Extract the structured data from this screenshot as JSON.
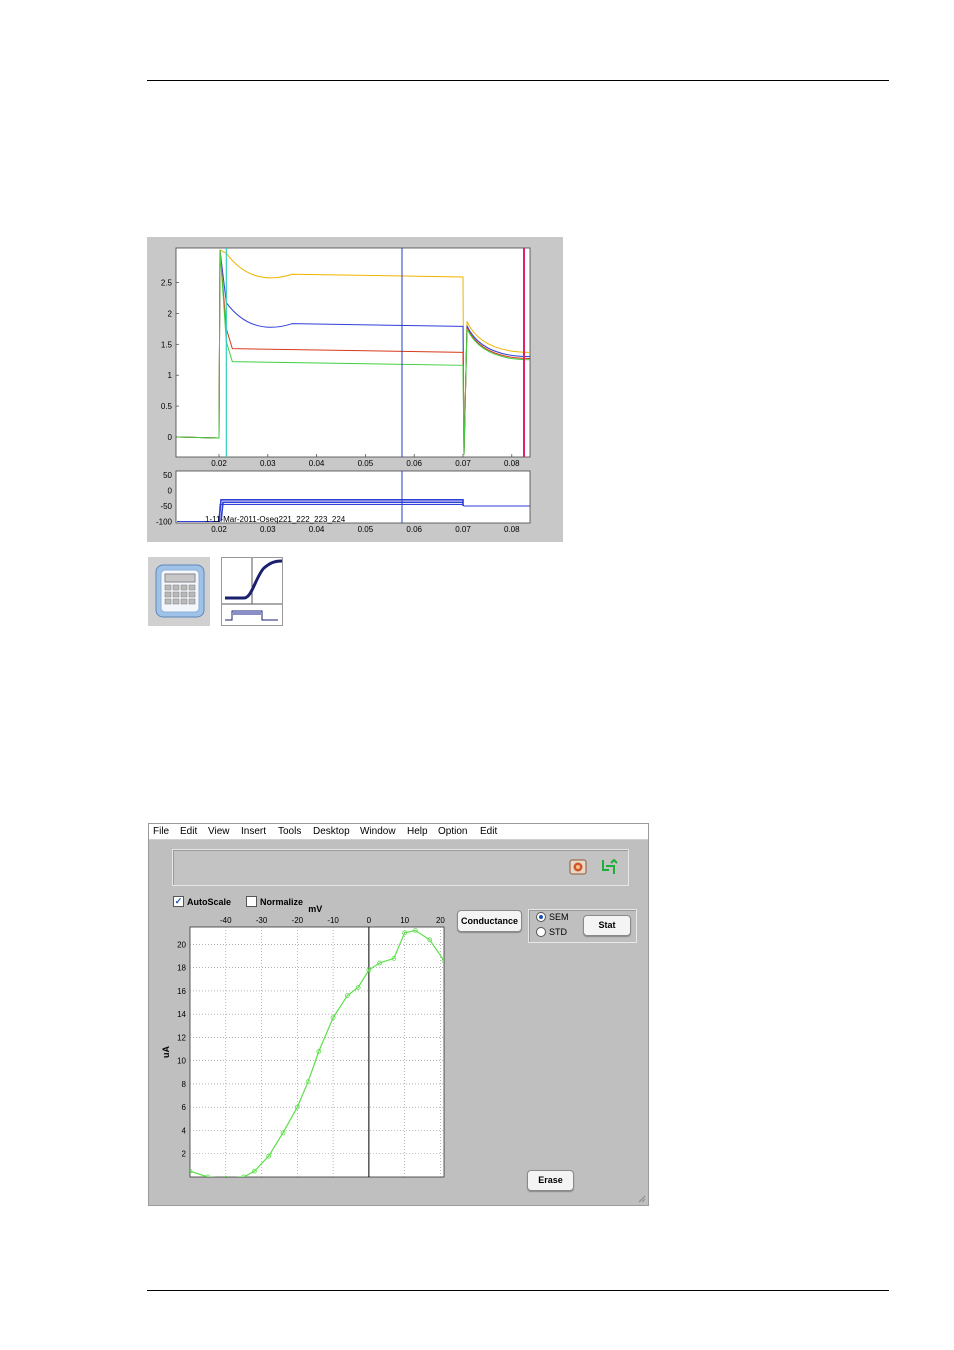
{
  "figure1": {
    "current_plot": {
      "y_ticks": [
        "2.5",
        "2",
        "1.5",
        "1",
        "0.5",
        "0"
      ],
      "x_ticks": [
        "0.02",
        "0.03",
        "0.04",
        "0.05",
        "0.06",
        "0.07",
        "0.08"
      ]
    },
    "voltage_plot": {
      "y_ticks": [
        "50",
        "0",
        "-50",
        "-100"
      ],
      "x_ticks": [
        "0.02",
        "0.03",
        "0.04",
        "0.05",
        "0.06",
        "0.07",
        "0.08"
      ],
      "annotation": "1-11-Mar-2011-Oseq221_222_223_224"
    },
    "trace_colors": {
      "orange": "#f0b400",
      "blue": "#2f3fd8",
      "red": "#d83a1a",
      "green": "#3fcf3f",
      "cursor_blue": "#1f3fc0",
      "cursor_magenta": "#e0206a",
      "cursor_cyan": "#30d0c0"
    }
  },
  "icons": {
    "calculator": "calculator-icon",
    "conductance_curve": "conductance-curve-icon"
  },
  "app": {
    "menu": [
      "File",
      "Edit",
      "View",
      "Insert",
      "Tools",
      "Desktop",
      "Window",
      "Help",
      "Option",
      "Edit"
    ],
    "toolbar_icons": [
      "photo-icon",
      "pan-tool-icon"
    ],
    "autoscale_label": "AutoScale",
    "autoscale_checked": true,
    "normalize_label": "Normalize",
    "normalize_checked": false,
    "x_unit_label": "mV",
    "y_unit_label": "uA",
    "conductance_label": "Conductance",
    "sem_label": "SEM",
    "std_label": "STD",
    "sem_selected": true,
    "stat_label": "Stat",
    "erase_label": "Erase",
    "x_ticks": [
      "-40",
      "-30",
      "-20",
      "-10",
      "0",
      "10",
      "20"
    ],
    "y_ticks": [
      "20",
      "18",
      "16",
      "14",
      "12",
      "10",
      "8",
      "6",
      "4",
      "2"
    ],
    "curve_color": "#5de04a"
  },
  "chart_data": {
    "type": "line",
    "xlim": [
      -50,
      21
    ],
    "ylim": [
      0,
      21.5
    ],
    "xlabel": "mV",
    "ylabel": "uA",
    "grid": true,
    "x": [
      -50,
      -45,
      -40,
      -35,
      -32,
      -28,
      -24,
      -20,
      -17,
      -14,
      -10,
      -6,
      -3,
      0,
      3,
      7,
      10,
      13,
      17,
      21
    ],
    "y": [
      0.5,
      0.0,
      -0.1,
      0.0,
      0.5,
      1.8,
      3.8,
      6.0,
      8.2,
      10.8,
      13.7,
      15.6,
      16.3,
      17.8,
      18.4,
      18.8,
      21.0,
      21.2,
      20.4,
      18.6
    ]
  }
}
